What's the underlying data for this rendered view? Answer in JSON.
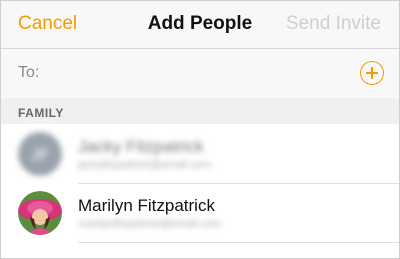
{
  "navbar": {
    "cancel_label": "Cancel",
    "title": "Add People",
    "send_label": "Send Invite"
  },
  "recipient": {
    "to_label": "To:",
    "value": ""
  },
  "section": {
    "title": "FAMILY"
  },
  "contacts": [
    {
      "name": "Jacky Fitzpatrick",
      "detail": "jackyfitzpatrick@email.com",
      "blurred": true
    },
    {
      "name": "Marilyn Fitzpatrick",
      "detail": "marilynfitzpatrick@email.com",
      "blurred": false
    }
  ],
  "colors": {
    "accent": "#f29b00",
    "disabled": "#cfcfcf"
  }
}
